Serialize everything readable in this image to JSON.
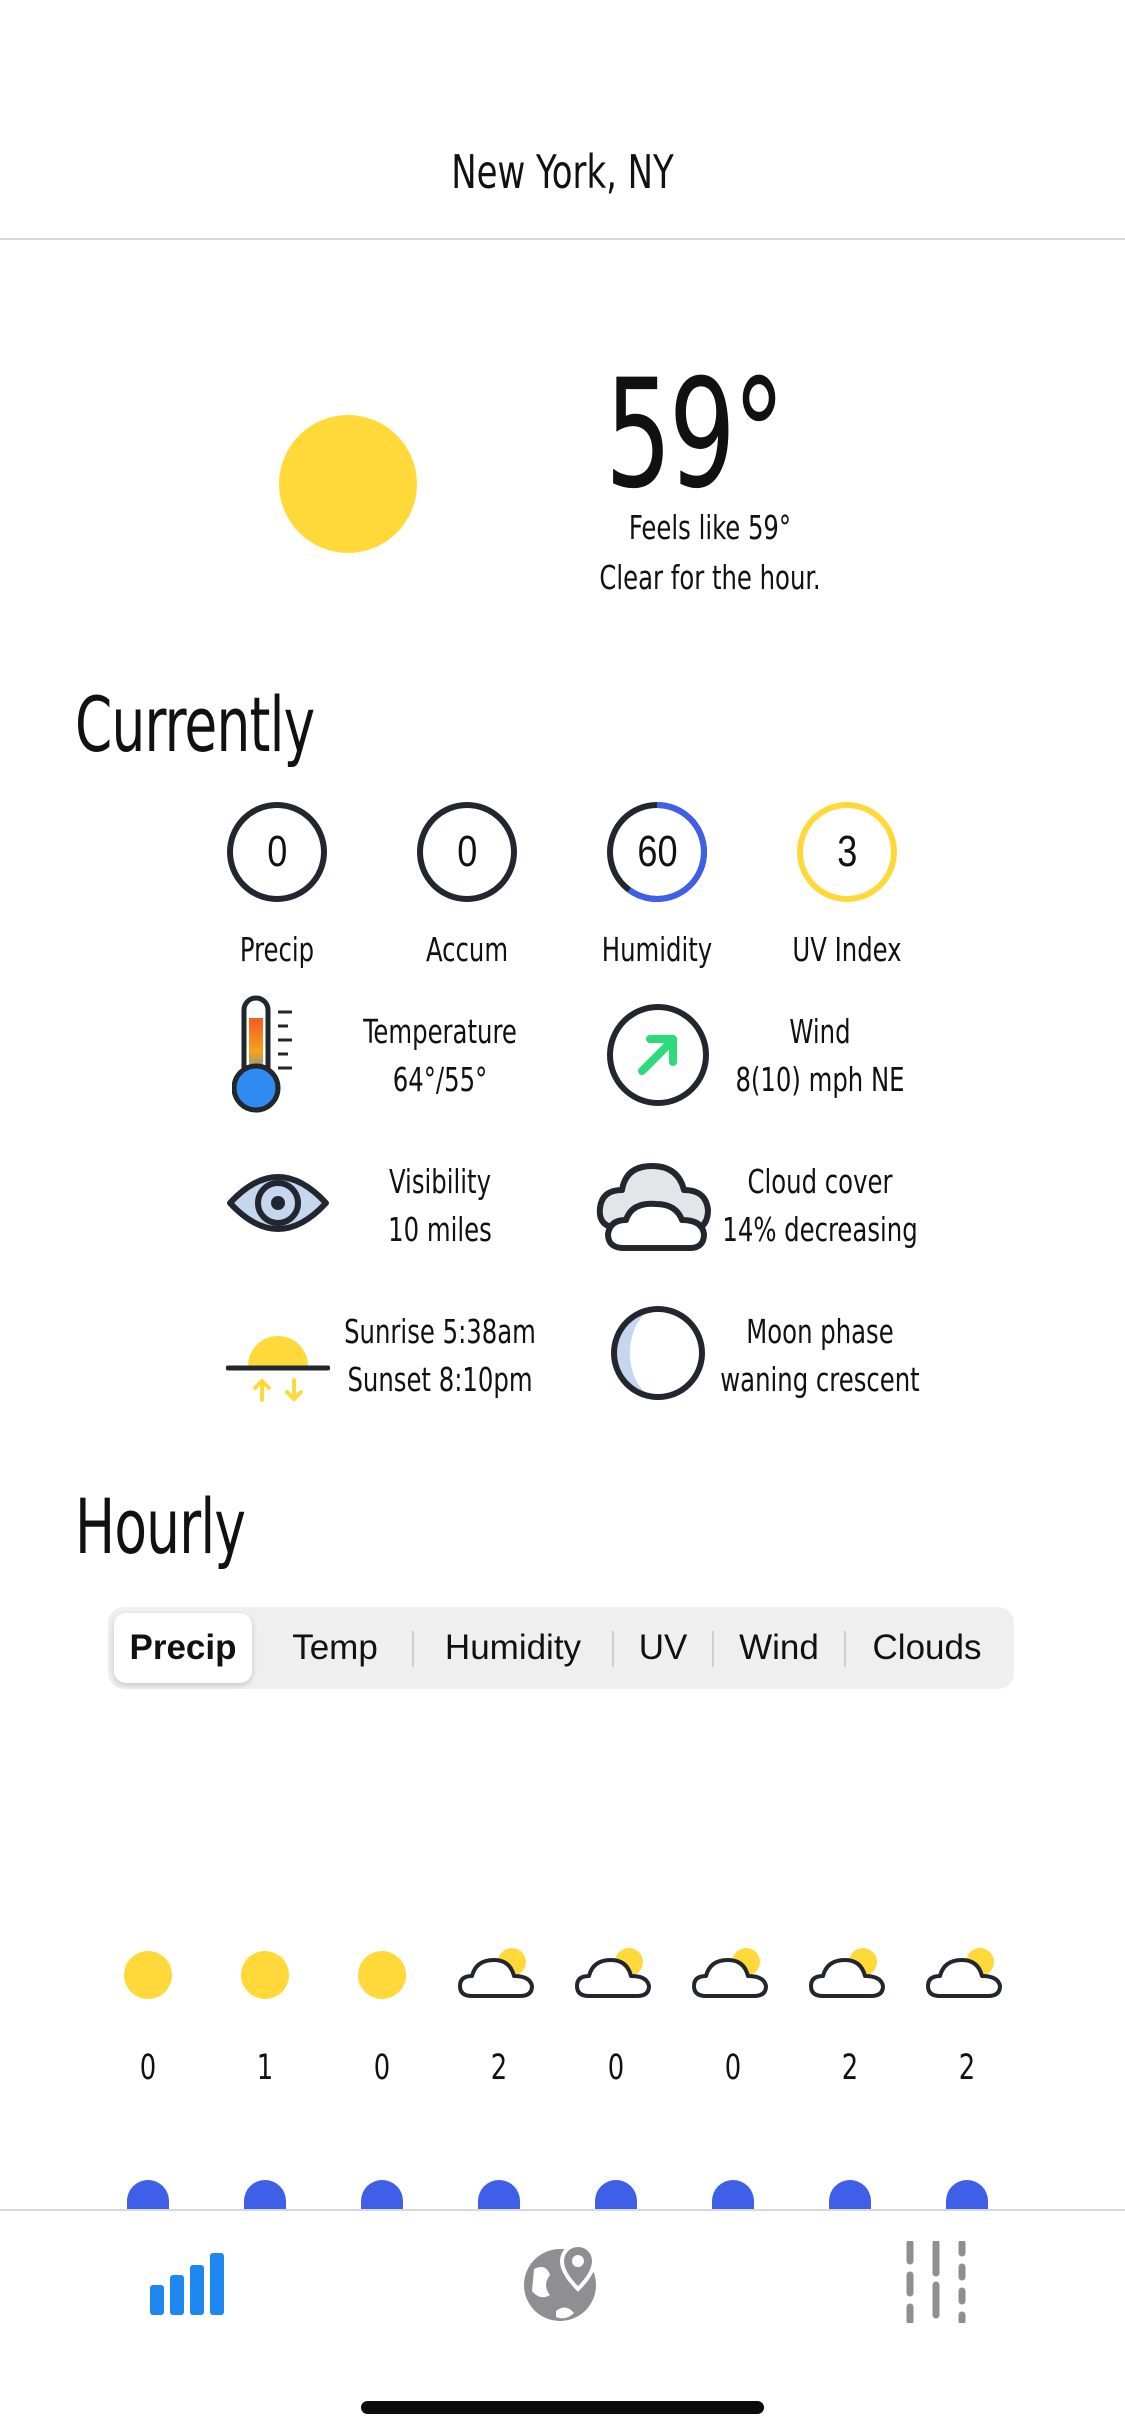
{
  "header": {
    "location": "New York, NY"
  },
  "hero": {
    "temperature": "59°",
    "feels_like": "Feels like 59°",
    "summary": "Clear for the hour.",
    "icon": "sun-icon",
    "sun_color": "#FFD93A"
  },
  "currently": {
    "title": "Currently",
    "stats": [
      {
        "label": "Precip",
        "value": "0"
      },
      {
        "label": "Accum",
        "value": "0"
      },
      {
        "label": "Humidity",
        "value": "60",
        "fraction": 0.6,
        "ring_color": "#3F5FE8"
      },
      {
        "label": "UV Index",
        "value": "3",
        "ring_color": "#FFD93A"
      }
    ],
    "temperature": {
      "label": "Temperature",
      "value": "64°/55°",
      "icon": "thermometer-icon"
    },
    "wind": {
      "label": "Wind",
      "value": "8(10) mph NE",
      "icon": "wind-direction-icon",
      "arrow_color": "#2EDB7A"
    },
    "visibility": {
      "label": "Visibility",
      "value": "10 miles",
      "icon": "eye-icon"
    },
    "cloud_cover": {
      "label": "Cloud cover",
      "value": "14% decreasing",
      "icon": "cloud-icon"
    },
    "sun": {
      "sunrise": "Sunrise 5:38am",
      "sunset": "Sunset 8:10pm",
      "icon": "sunrise-sunset-icon"
    },
    "moon": {
      "label": "Moon phase",
      "value": "waning crescent",
      "icon": "moon-phase-icon"
    }
  },
  "hourly": {
    "title": "Hourly",
    "tabs": [
      "Precip",
      "Temp",
      "Humidity",
      "UV",
      "Wind",
      "Clouds"
    ],
    "active_tab": "Precip",
    "items": [
      {
        "icon": "sun-icon",
        "value": "0"
      },
      {
        "icon": "sun-icon",
        "value": "1"
      },
      {
        "icon": "sun-icon",
        "value": "0"
      },
      {
        "icon": "partly-cloudy-icon",
        "value": "2"
      },
      {
        "icon": "partly-cloudy-icon",
        "value": "0"
      },
      {
        "icon": "partly-cloudy-icon",
        "value": "0"
      },
      {
        "icon": "partly-cloudy-icon",
        "value": "2"
      },
      {
        "icon": "partly-cloudy-icon",
        "value": "2"
      }
    ],
    "bar_color": "#3F5FE8"
  },
  "tabbar": {
    "items": [
      {
        "icon": "chart-bars-icon",
        "active": true,
        "color": "#1E88F0"
      },
      {
        "icon": "globe-pin-icon",
        "active": false,
        "color": "#8e8e93"
      },
      {
        "icon": "sliders-icon",
        "active": false,
        "color": "#8e8e93"
      }
    ]
  }
}
